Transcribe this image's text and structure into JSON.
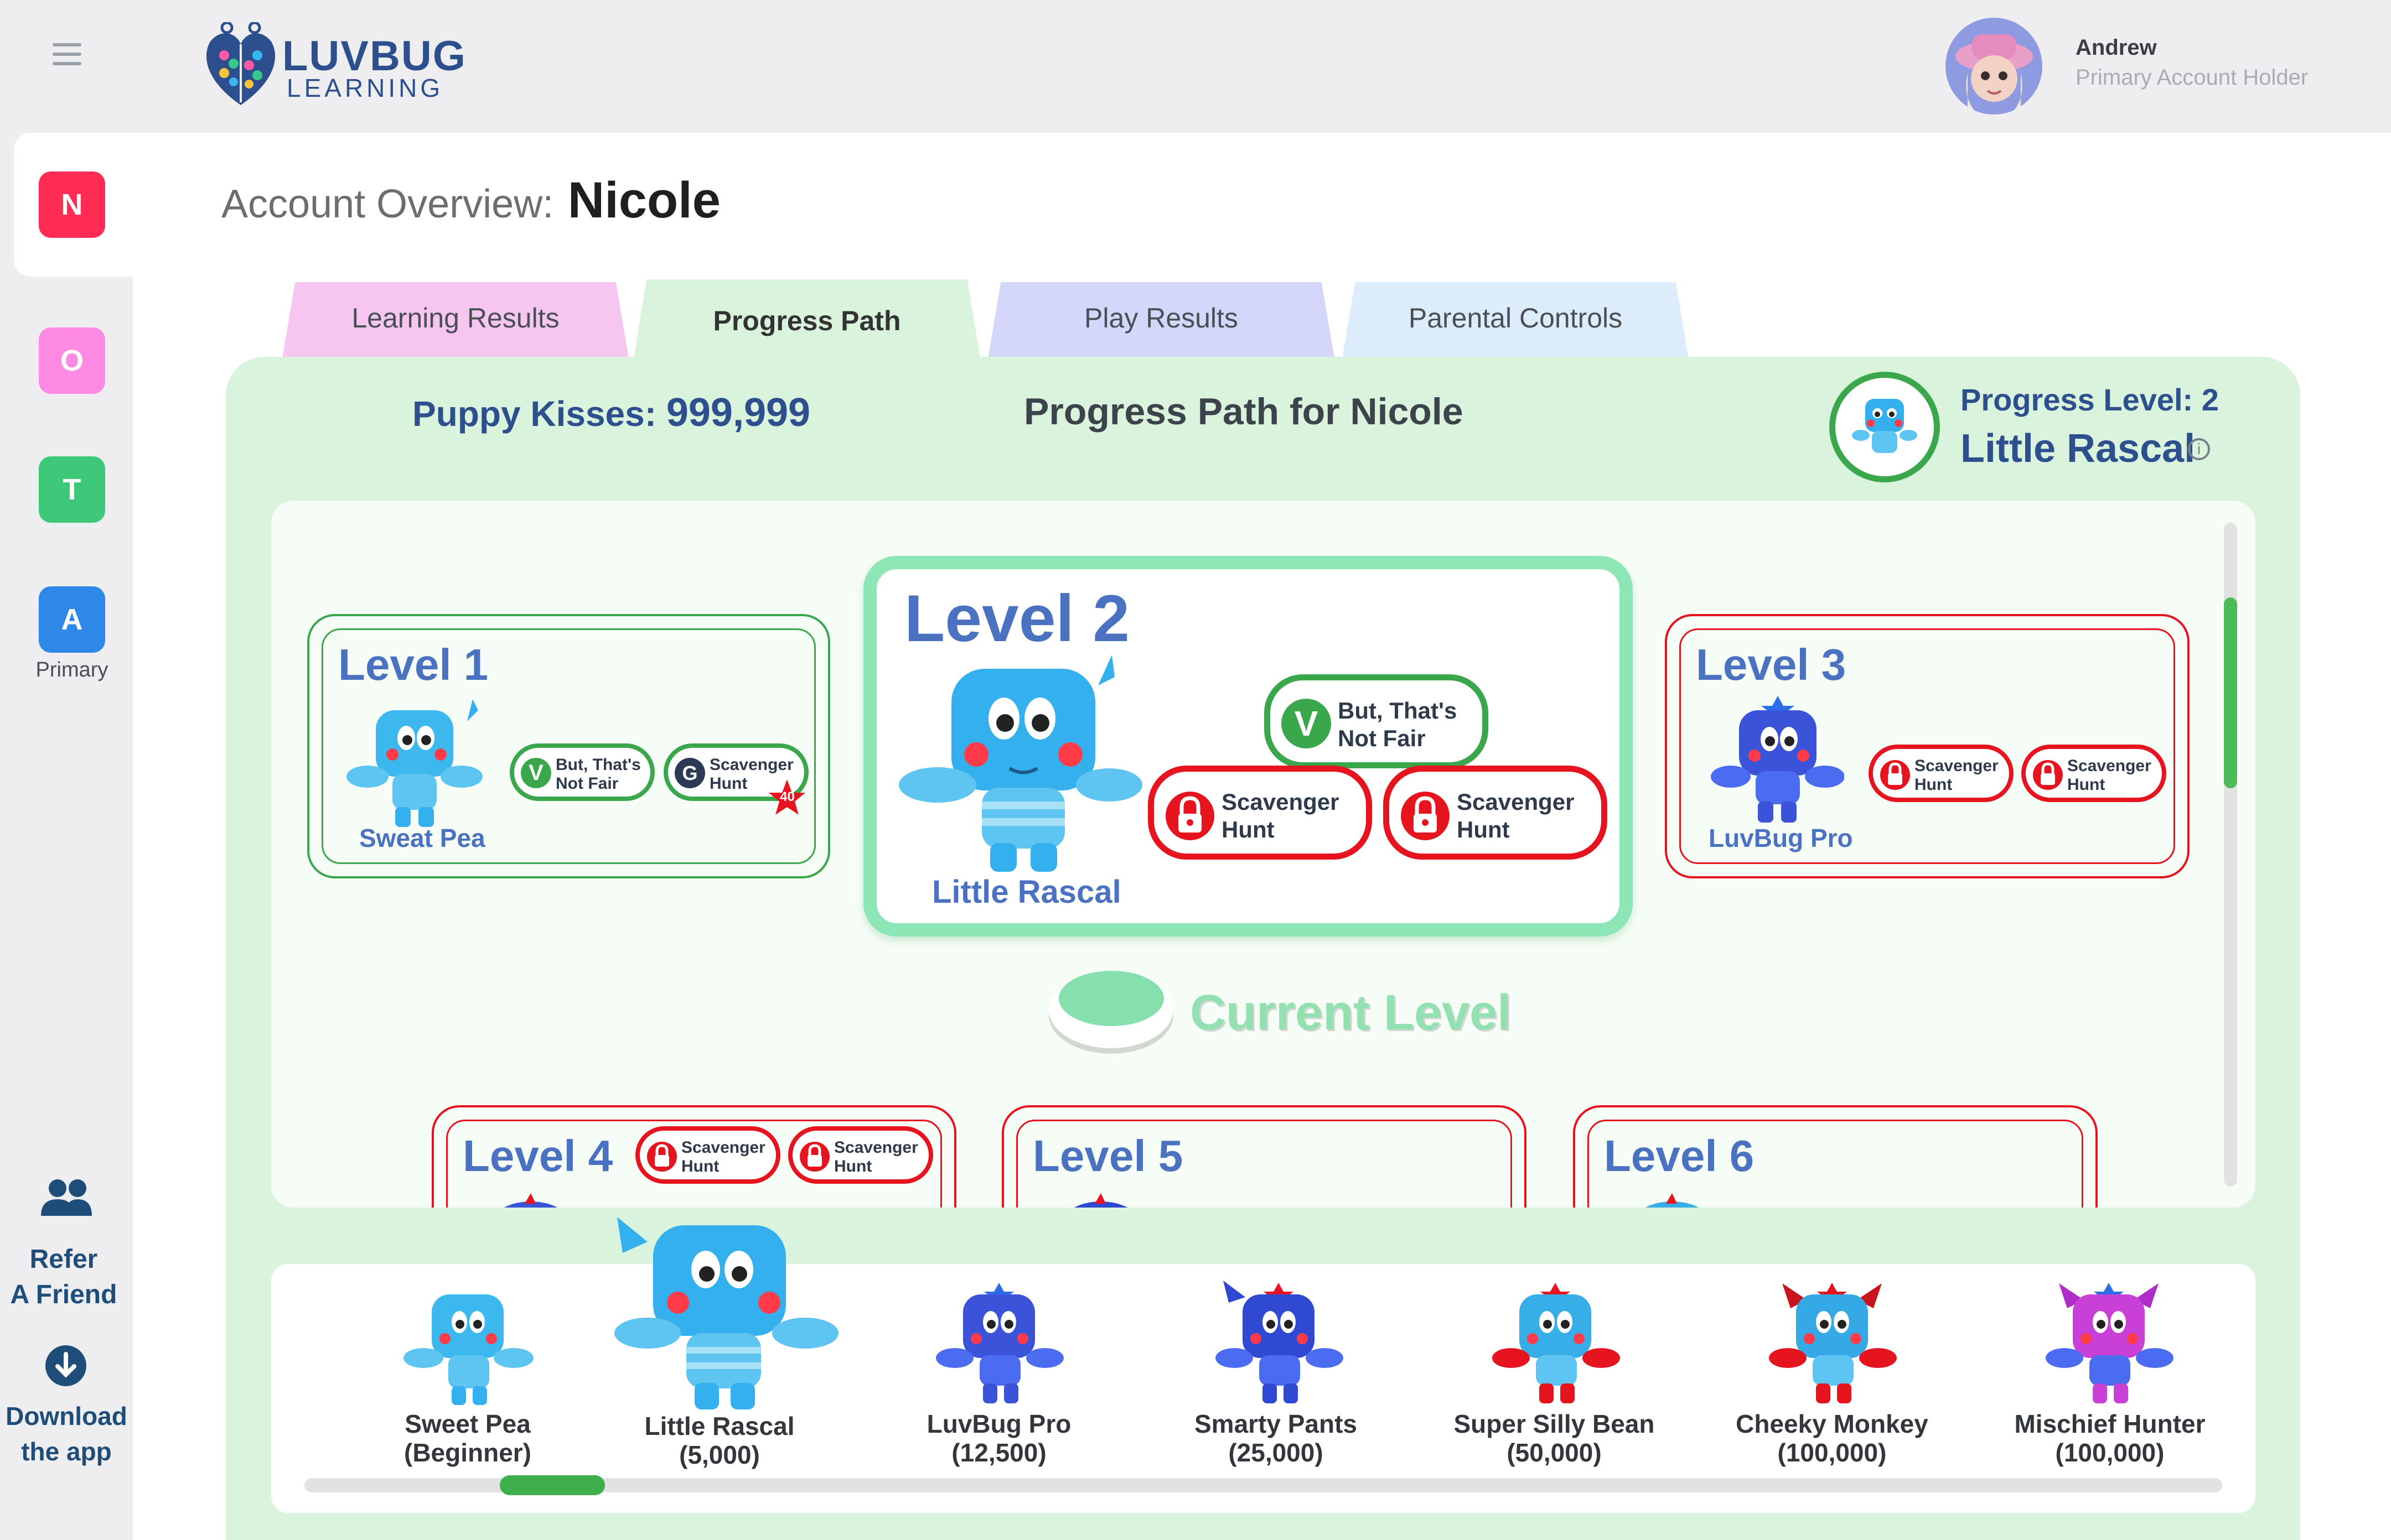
{
  "header": {
    "logo_line1": "LUVBUG",
    "logo_line2": "LEARNING",
    "user_name": "Andrew",
    "user_role": "Primary Account Holder"
  },
  "sidebar": {
    "profiles": [
      {
        "letter": "N",
        "color": "#ff2d55",
        "label": ""
      },
      {
        "letter": "O",
        "color": "#ff8ae3",
        "label": ""
      },
      {
        "letter": "T",
        "color": "#3ec97a",
        "label": ""
      },
      {
        "letter": "A",
        "color": "#2e88e8",
        "label": "Primary"
      }
    ],
    "refer_line1": "Refer",
    "refer_line2": "A Friend",
    "download_line1": "Download",
    "download_line2": "the app"
  },
  "page": {
    "title_label": "Account Overview:",
    "title_name": "Nicole"
  },
  "tabs": [
    {
      "label": "Learning Results",
      "color": "#f6c6f0"
    },
    {
      "label": "Progress Path",
      "color": "#d9f3dc"
    },
    {
      "label": "Play Results",
      "color": "#d4d6fa"
    },
    {
      "label": "Parental Controls",
      "color": "#dcecfb"
    }
  ],
  "panel": {
    "kisses_label": "Puppy Kisses:",
    "kisses_value": "999,999",
    "path_title": "Progress Path for Nicole",
    "progress_level": "Progress Level: 2",
    "progress_name": "Little Rascal",
    "current_level": "Current Level"
  },
  "levels": [
    {
      "title": "Level 1",
      "name": "Sweat Pea",
      "pills": [
        {
          "icon": "V",
          "text1": "But, That's",
          "text2": "Not Fair"
        },
        {
          "icon": "G",
          "text1": "Scavenger",
          "text2": "Hunt",
          "star": "40"
        }
      ]
    },
    {
      "title": "Level 2",
      "name": "Little Rascal",
      "pills": [
        {
          "icon": "V",
          "text1": "But, That's",
          "text2": "Not Fair"
        },
        {
          "icon": "lock",
          "text1": "Scavenger",
          "text2": "Hunt"
        },
        {
          "icon": "lock",
          "text1": "Scavenger",
          "text2": "Hunt"
        }
      ]
    },
    {
      "title": "Level 3",
      "name": "LuvBug Pro",
      "pills": [
        {
          "icon": "lock",
          "text1": "Scavenger",
          "text2": "Hunt"
        },
        {
          "icon": "lock",
          "text1": "Scavenger",
          "text2": "Hunt"
        }
      ]
    },
    {
      "title": "Level 4",
      "name": "",
      "pills": [
        {
          "icon": "lock",
          "text1": "Scavenger",
          "text2": "Hunt"
        },
        {
          "icon": "lock",
          "text1": "Scavenger",
          "text2": "Hunt"
        }
      ]
    },
    {
      "title": "Level 5",
      "name": "",
      "pills": []
    },
    {
      "title": "Level 6",
      "name": "",
      "pills": []
    }
  ],
  "characters": [
    {
      "name": "Sweet Pea",
      "points": "(Beginner)",
      "color": "#3cb8ef"
    },
    {
      "name": "Little Rascal",
      "points": "(5,000)",
      "color": "#35b0ee"
    },
    {
      "name": "LuvBug Pro",
      "points": "(12,500)",
      "color": "#3a53d8"
    },
    {
      "name": "Smarty Pants",
      "points": "(25,000)",
      "color": "#3049d2"
    },
    {
      "name": "Super Silly Bean",
      "points": "(50,000)",
      "color": "#38aee8"
    },
    {
      "name": "Cheeky Monkey",
      "points": "(100,000)",
      "color": "#35a9e6"
    },
    {
      "name": "Mischief Hunter",
      "points": "(100,000)",
      "color": "#c840d6"
    }
  ],
  "colors": {
    "green_accent": "#3ba74d",
    "locked_red": "#e5141e",
    "level_blue": "#4a72c0"
  }
}
